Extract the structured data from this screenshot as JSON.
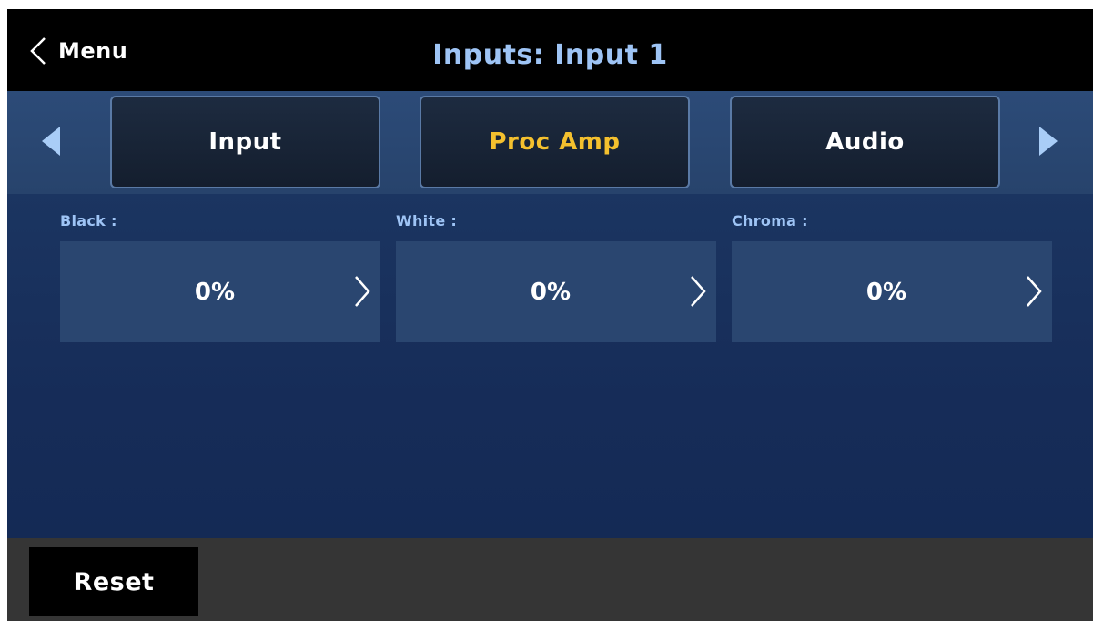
{
  "header": {
    "back_label": "Menu",
    "back_icon": "chevron-left-icon",
    "title": "Inputs: Input 1"
  },
  "tabs": {
    "items": [
      {
        "label": "Input",
        "active": false
      },
      {
        "label": "Proc Amp",
        "active": true
      },
      {
        "label": "Audio",
        "active": false
      }
    ],
    "prev_icon": "triangle-left-icon",
    "next_icon": "triangle-right-icon"
  },
  "params": [
    {
      "label": "Black :",
      "value": "0%"
    },
    {
      "label": "White :",
      "value": "0%"
    },
    {
      "label": "Chroma :",
      "value": "0%"
    }
  ],
  "footer": {
    "reset_label": "Reset"
  },
  "colors": {
    "title": "#9ec4f5",
    "active_tab": "#f4c02e",
    "content_bg": "#162c58",
    "param_bg": "#2a4670",
    "footer_bg": "#353535"
  }
}
